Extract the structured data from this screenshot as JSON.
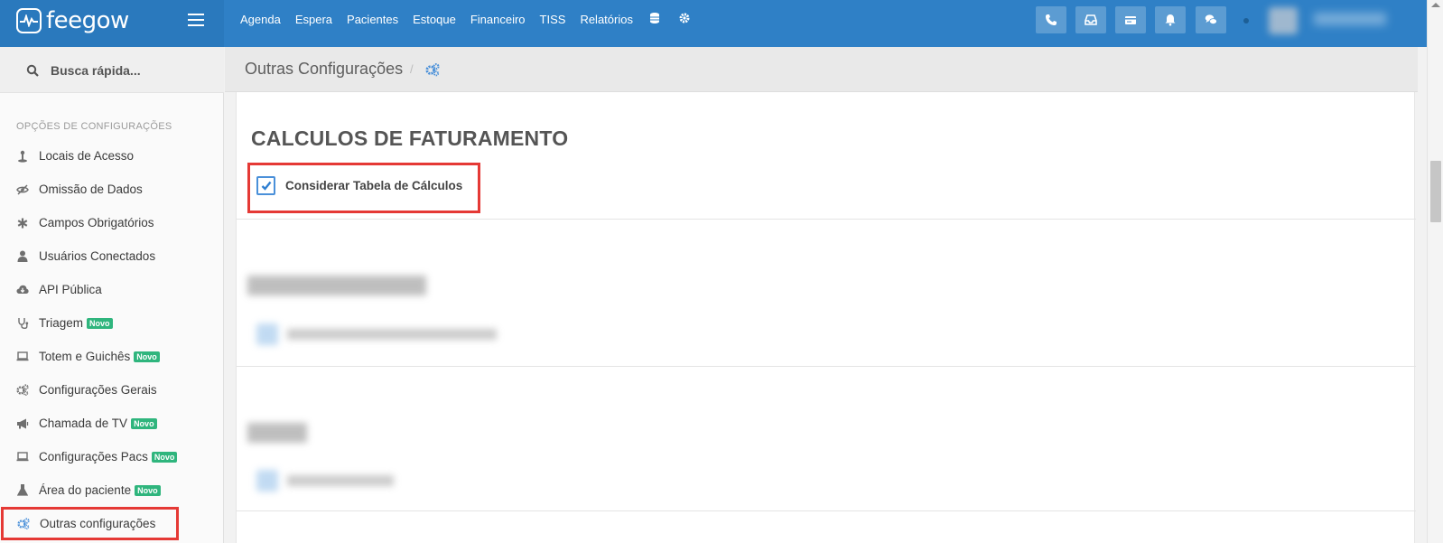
{
  "brand": {
    "name": "feegow"
  },
  "nav": {
    "items": [
      "Agenda",
      "Espera",
      "Pacientes",
      "Estoque",
      "Financeiro",
      "TISS",
      "Relatórios"
    ]
  },
  "search": {
    "label": "Busca rápida..."
  },
  "sidebar": {
    "section_title": "OPÇÕES DE CONFIGURAÇÕES",
    "items": [
      {
        "label": "Locais de Acesso",
        "icon": "location-icon"
      },
      {
        "label": "Omissão de Dados",
        "icon": "eye-slash-icon"
      },
      {
        "label": "Campos Obrigatórios",
        "icon": "asterisk-icon"
      },
      {
        "label": "Usuários Conectados",
        "icon": "user-icon"
      },
      {
        "label": "API Pública",
        "icon": "cloud-icon"
      },
      {
        "label": "Triagem",
        "icon": "stethoscope-icon",
        "badge": "Novo"
      },
      {
        "label": "Totem e Guichês",
        "icon": "laptop-icon",
        "badge": "Novo"
      },
      {
        "label": "Configurações Gerais",
        "icon": "gears-icon"
      },
      {
        "label": "Chamada de TV",
        "icon": "megaphone-icon",
        "badge": "Novo"
      },
      {
        "label": "Configurações Pacs",
        "icon": "laptop-icon",
        "badge": "Novo"
      },
      {
        "label": "Área do paciente",
        "icon": "flask-icon",
        "badge": "Novo"
      },
      {
        "label": "Outras configurações",
        "icon": "gears-icon"
      }
    ]
  },
  "header": {
    "title": "Outras Configurações",
    "separator": "/"
  },
  "content": {
    "sections": [
      {
        "title": "CALCULOS DE FATURAMENTO",
        "checkbox_label": "Considerar Tabela de Cálculos",
        "checked": true
      }
    ]
  },
  "colors": {
    "topbar": "#2f80c6",
    "accent": "#4a90d9",
    "badge": "#2fb57d",
    "highlight": "#e53935"
  }
}
